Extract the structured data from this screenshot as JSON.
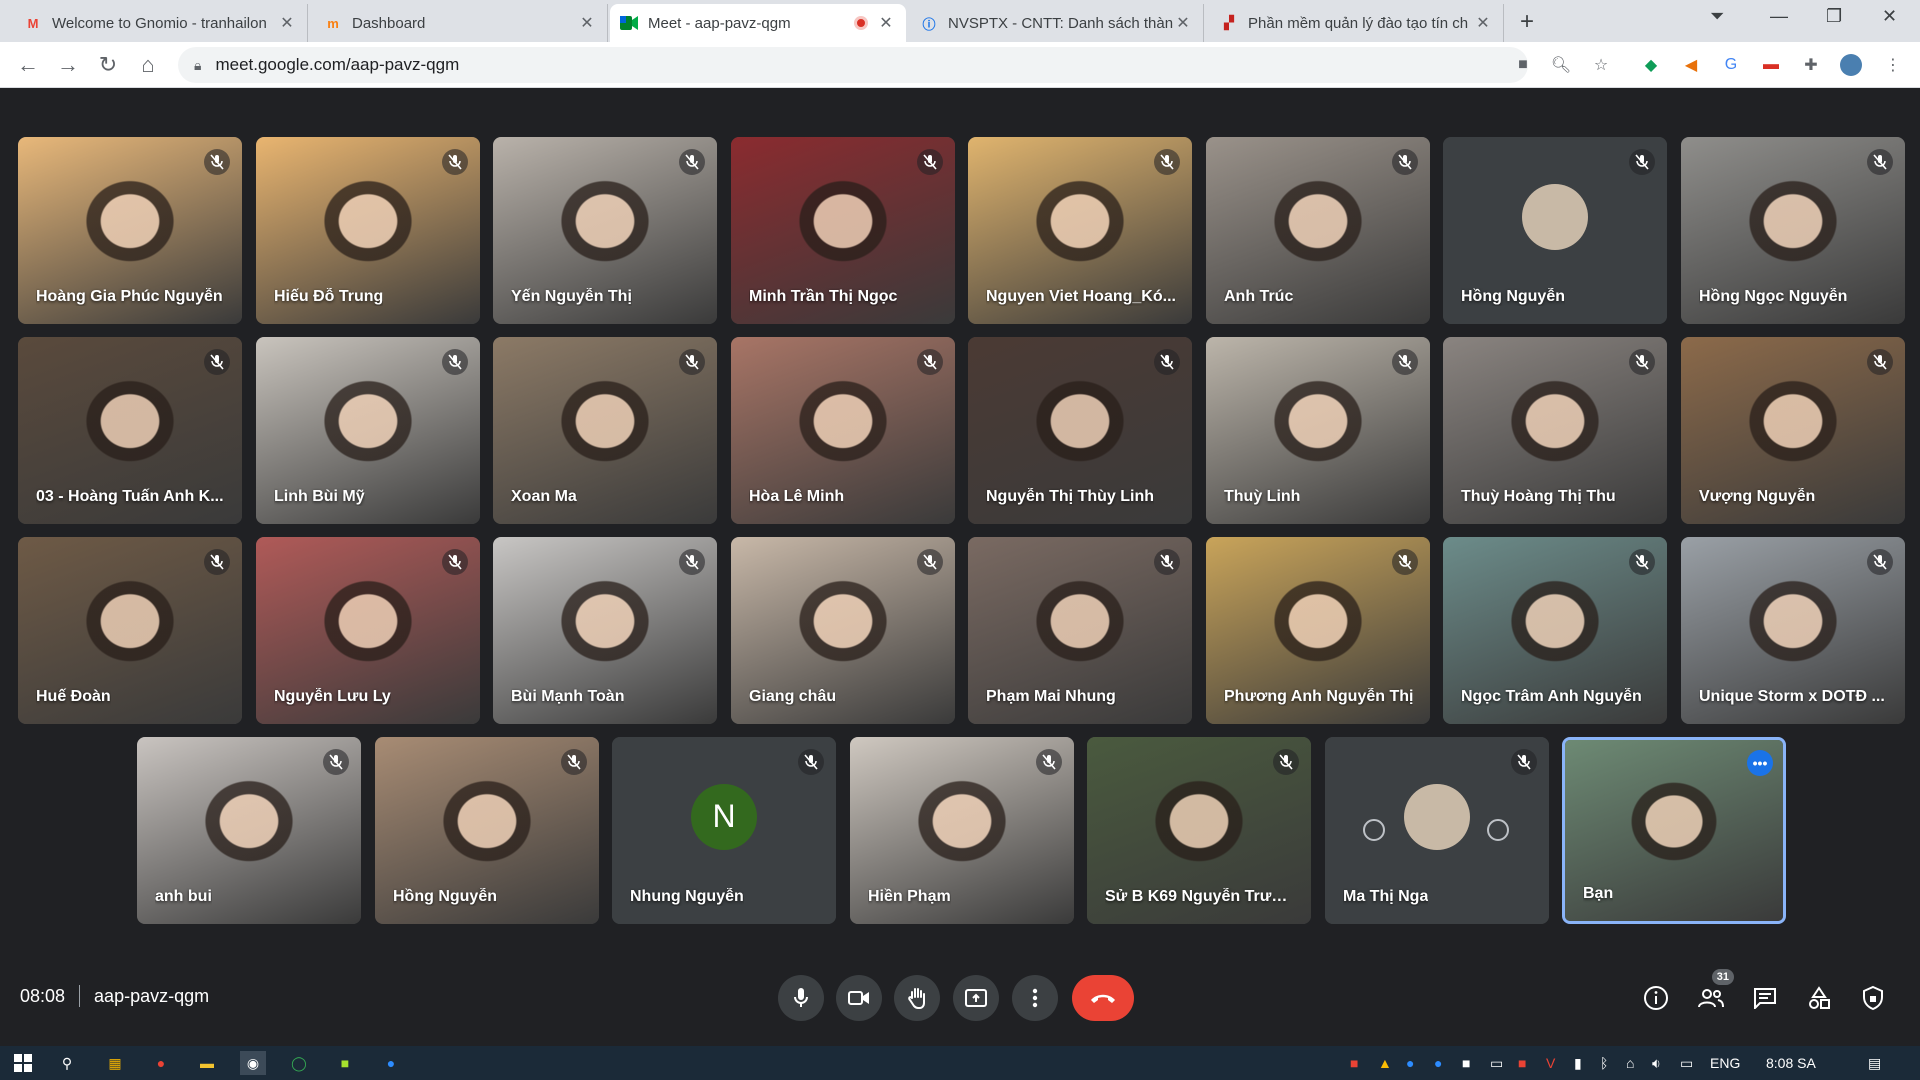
{
  "browser": {
    "tabs": [
      {
        "title": "Welcome to Gnomio - tranhailon",
        "icon": "gmail-icon",
        "active": false
      },
      {
        "title": "Dashboard",
        "icon": "moodle-icon",
        "active": false
      },
      {
        "title": "Meet - aap-pavz-qgm",
        "icon": "meet-icon",
        "active": true,
        "recording": true
      },
      {
        "title": "NVSPTX - CNTT: Danh sách thành",
        "icon": "info-icon",
        "active": false
      },
      {
        "title": "Phần mềm quản lý đào tạo tín ch",
        "icon": "document-icon",
        "active": false
      }
    ],
    "address": "meet.google.com/aap-pavz-qgm"
  },
  "participants": [
    {
      "name": "Hoàng Gia Phúc Nguyễn",
      "bg": "#e8b87a"
    },
    {
      "name": "Hiếu Đỗ Trung",
      "bg": "#e9b570"
    },
    {
      "name": "Yến Nguyễn Thị",
      "bg": "#b9b2aa"
    },
    {
      "name": "Minh Trần Thị Ngọc",
      "bg": "#8b2b2f"
    },
    {
      "name": "Nguyen Viet Hoang_Kó...",
      "bg": "#e0b46e"
    },
    {
      "name": "Anh Trúc",
      "bg": "#9a928a"
    },
    {
      "name": "Hồng Nguyễn",
      "bg": "#3c4043",
      "avatar": true
    },
    {
      "name": "Hồng Ngọc Nguyễn",
      "bg": "#8f8e8b"
    },
    {
      "name": "03 - Hoàng Tuấn Anh K...",
      "bg": "#5a4a3c"
    },
    {
      "name": "Linh Bùi Mỹ",
      "bg": "#c9c4bd"
    },
    {
      "name": "Xoan Ma",
      "bg": "#8c7a66"
    },
    {
      "name": "Hòa Lê Minh",
      "bg": "#a87566"
    },
    {
      "name": "Nguyễn Thị Thùy Linh",
      "bg": "#4b3a34"
    },
    {
      "name": "Thuỳ Linh",
      "bg": "#bcb5aa"
    },
    {
      "name": "Thuỳ Hoàng Thị Thu",
      "bg": "#8a8480"
    },
    {
      "name": "Vượng Nguyễn",
      "bg": "#8c6a4a"
    },
    {
      "name": "Huế Đoàn",
      "bg": "#6e5a46"
    },
    {
      "name": "Nguyễn Lưu Ly",
      "bg": "#b05a58"
    },
    {
      "name": "Bùi Mạnh Toàn",
      "bg": "#c8c6c4"
    },
    {
      "name": "Giang châu",
      "bg": "#c8b8a8"
    },
    {
      "name": "Phạm Mai Nhung",
      "bg": "#7a6a62"
    },
    {
      "name": "Phương Anh Nguyễn Thị",
      "bg": "#c9a45a"
    },
    {
      "name": "Ngọc Trâm Anh Nguyễn",
      "bg": "#6c8c8a"
    },
    {
      "name": "Unique Storm x DOTĐ ...",
      "bg": "#9aa0a6"
    },
    {
      "name": "anh bui",
      "bg": "#c9c4c0"
    },
    {
      "name": "Hồng Nguyễn",
      "bg": "#a88c74"
    },
    {
      "name": "Nhung Nguyễn",
      "bg": "#3c4043",
      "letter": "N"
    },
    {
      "name": "Hiền Phạm",
      "bg": "#cfc8c0"
    },
    {
      "name": "Sử B K69 Nguyễn Trươn...",
      "bg": "#4a5a3e"
    },
    {
      "name": "Ma Thị Nga",
      "bg": "#3c4043",
      "avatar": true
    },
    {
      "name": "Bạn",
      "bg": "#6d8a74",
      "self": true
    }
  ],
  "meeting": {
    "time": "08:08",
    "code": "aap-pavz-qgm",
    "people_count": "31"
  },
  "taskbar": {
    "lang": "ENG",
    "clock": "8:08 SA"
  }
}
